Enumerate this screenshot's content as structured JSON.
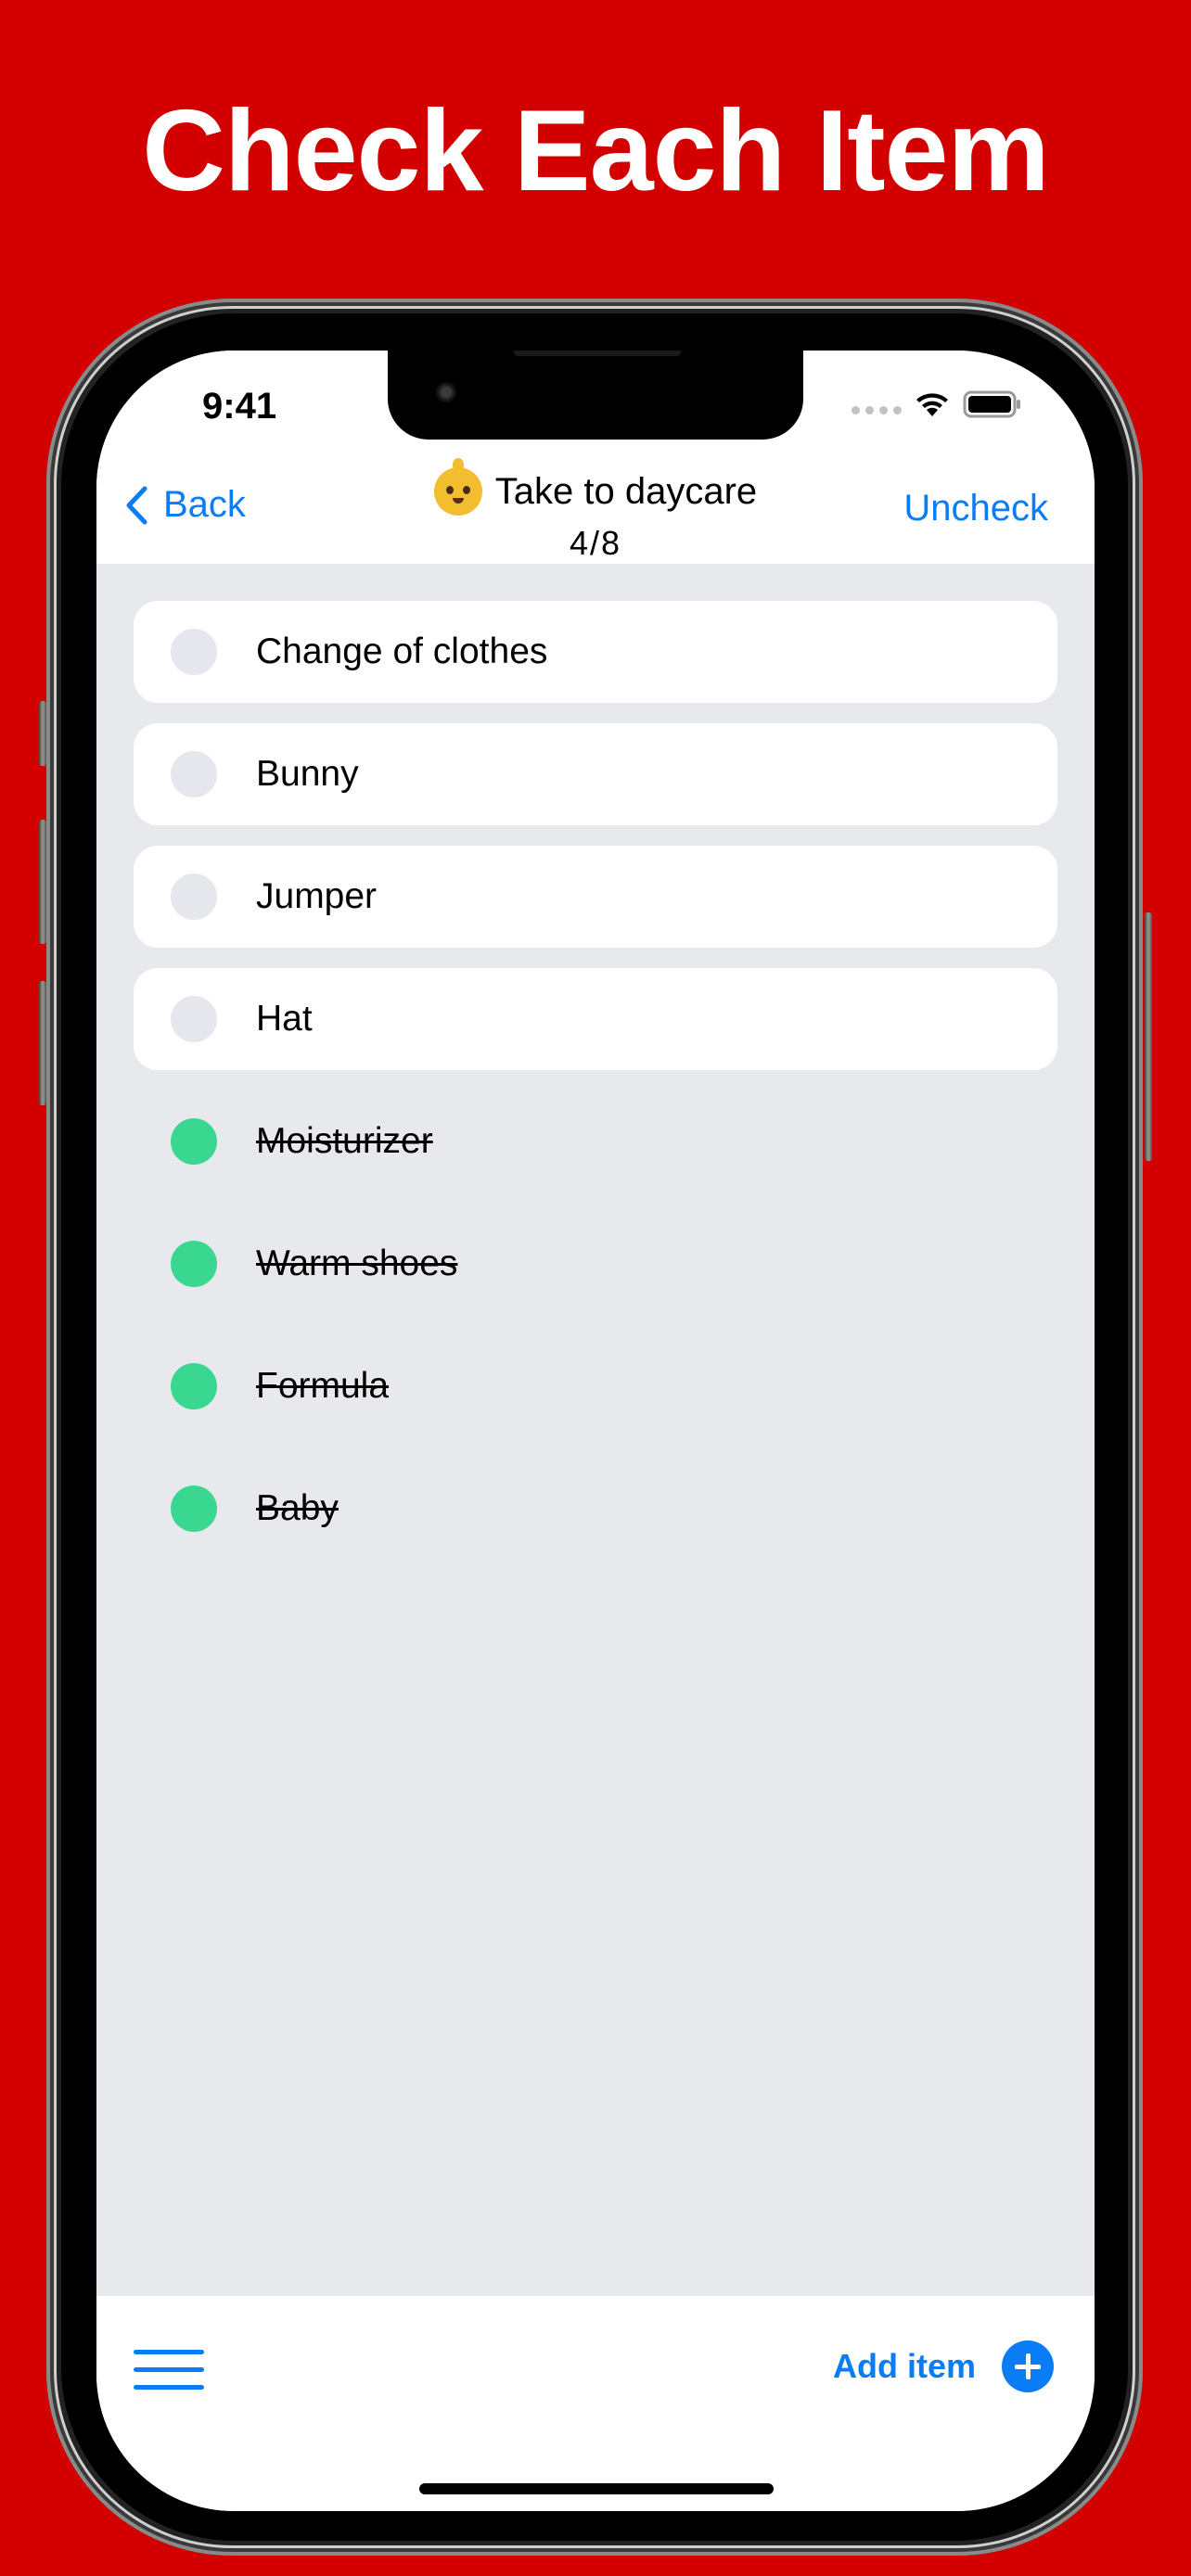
{
  "headline": "Check Each Item",
  "status_bar": {
    "time": "9:41",
    "signal_icon": "signal-dots-icon",
    "wifi_icon": "wifi-icon",
    "battery_icon": "battery-icon"
  },
  "nav": {
    "back_label": "Back",
    "back_icon": "chevron-left-icon",
    "title_emoji": "baby-emoji-icon",
    "title": "Take to daycare",
    "progress": "4/8",
    "right_action": "Uncheck"
  },
  "items": [
    {
      "label": "Change of clothes",
      "checked": false
    },
    {
      "label": "Bunny",
      "checked": false
    },
    {
      "label": "Jumper",
      "checked": false
    },
    {
      "label": "Hat",
      "checked": false
    },
    {
      "label": "Moisturizer",
      "checked": true
    },
    {
      "label": "Warm shoes",
      "checked": true
    },
    {
      "label": "Formula",
      "checked": true
    },
    {
      "label": "Baby",
      "checked": true
    }
  ],
  "toolbar": {
    "menu_icon": "hamburger-menu-icon",
    "add_label": "Add item",
    "add_icon": "plus-circle-icon"
  },
  "colors": {
    "background": "#d30000",
    "accent": "#0a7cf5",
    "checked": "#3ad791",
    "unchecked": "#e6e7ec",
    "list_background": "#e8e9ed"
  }
}
